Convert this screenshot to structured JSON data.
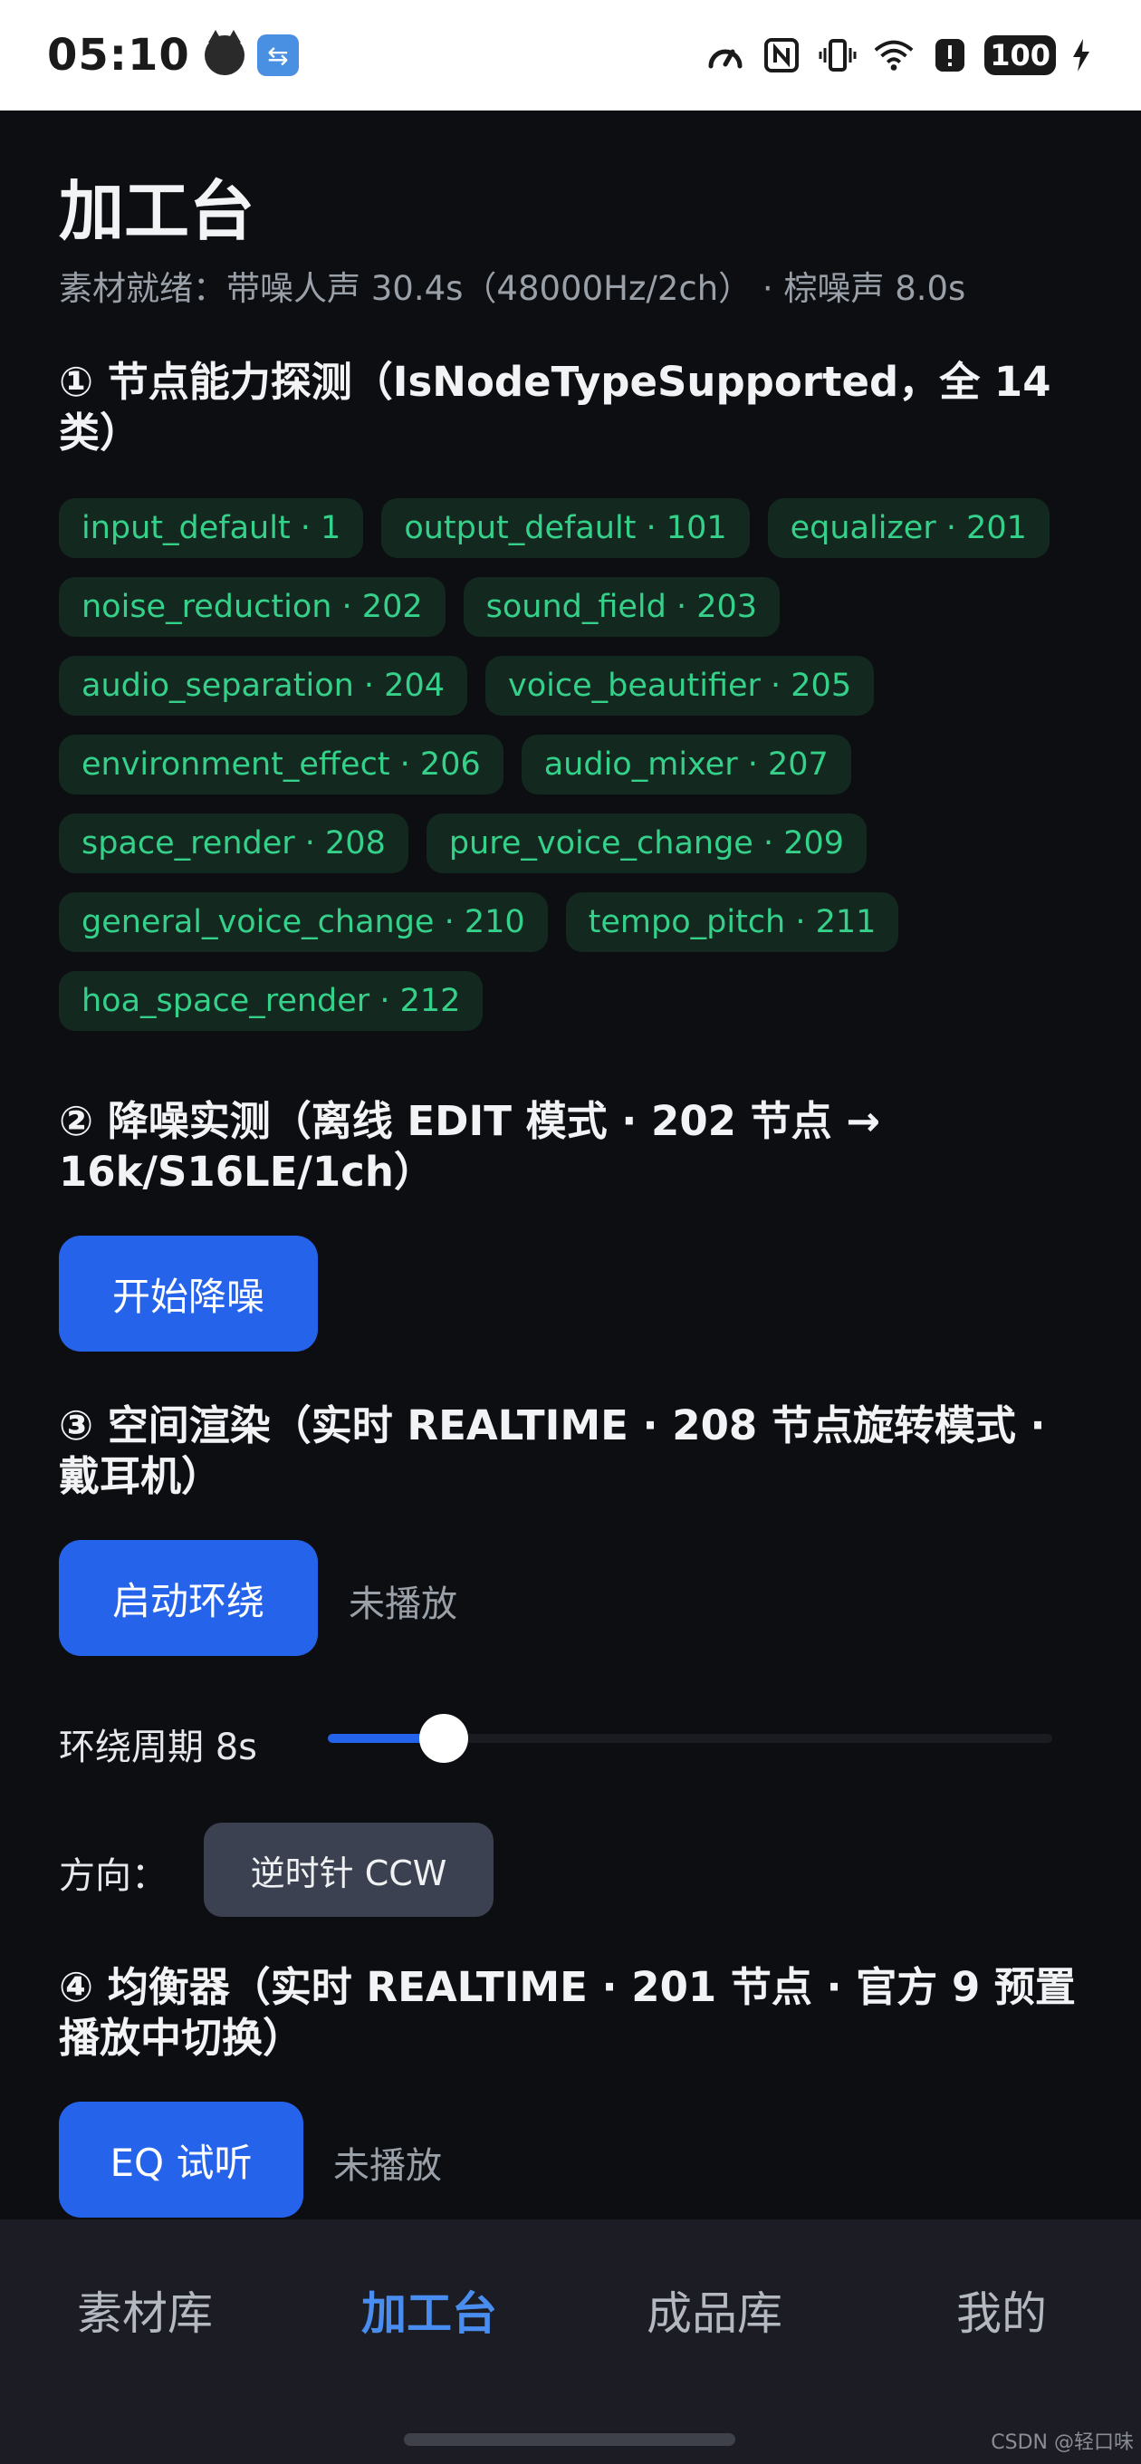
{
  "status_bar": {
    "time": "05:10",
    "left_icons": [
      "cat-avatar-icon",
      "usb-icon"
    ],
    "right_icons": [
      "speedometer-icon",
      "nfc-icon",
      "vibrate-icon",
      "wifi-icon",
      "alert-icon"
    ],
    "battery": "100",
    "charging": true
  },
  "page": {
    "title": "加工台",
    "subtitle": "素材就绪：带噪人声 30.4s（48000Hz/2ch） · 棕噪声 8.0s"
  },
  "section1": {
    "title": "① 节点能力探测（IsNodeTypeSupported，全 14 类）",
    "chips": [
      "input_default · 1",
      "output_default · 101",
      "equalizer · 201",
      "noise_reduction · 202",
      "sound_field · 203",
      "audio_separation · 204",
      "voice_beautifier · 205",
      "environment_effect · 206",
      "audio_mixer · 207",
      "space_render · 208",
      "pure_voice_change · 209",
      "general_voice_change · 210",
      "tempo_pitch · 211",
      "hoa_space_render · 212"
    ]
  },
  "section2": {
    "title": "② 降噪实测（离线 EDIT 模式 · 202 节点 → 16k/S16LE/1ch）",
    "button": "开始降噪"
  },
  "section3": {
    "title": "③ 空间渲染（实时 REALTIME · 208 节点旋转模式 · 戴耳机）",
    "button": "启动环绕",
    "status": "未播放",
    "slider_label": "环绕周期 8s",
    "slider_fraction": 0.16,
    "direction_label": "方向：",
    "direction_button": "逆时针 CCW"
  },
  "section4": {
    "title": "④ 均衡器（实时 REALTIME · 201 节点 · 官方 9 预置播放中切换）",
    "button": "EQ 试听",
    "status": "未播放"
  },
  "tabs": [
    {
      "label": "素材库",
      "active": false
    },
    {
      "label": "加工台",
      "active": true
    },
    {
      "label": "成品库",
      "active": false
    },
    {
      "label": "我的",
      "active": false
    }
  ],
  "watermark": "CSDN @轻口味",
  "colors": {
    "accent": "#2563eb",
    "chip_text": "#35d08a",
    "chip_bg": "#13291f",
    "active_tab": "#4a8df0"
  }
}
